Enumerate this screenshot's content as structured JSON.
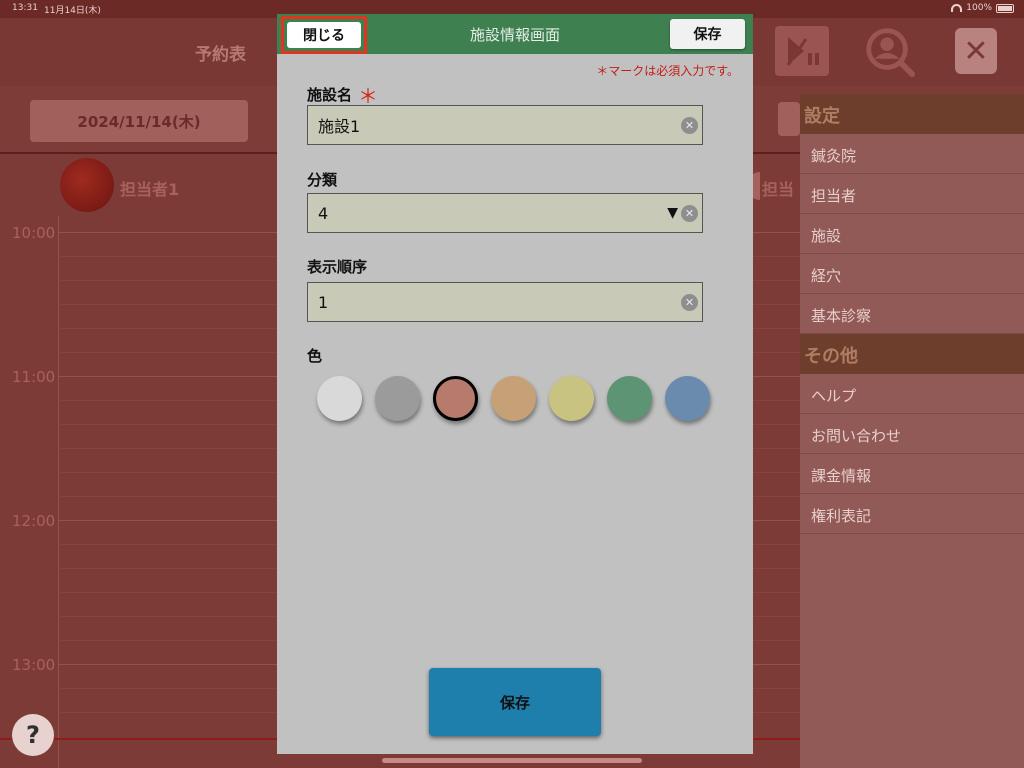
{
  "status_bar": {
    "time": "13:31",
    "date": "11月14日(木)",
    "battery": "100%"
  },
  "app": {
    "title": "予約表",
    "date": "2024/11/14(木)",
    "staff": [
      "担当者1",
      "担当"
    ],
    "times": [
      "10:00",
      "11:00",
      "12:00",
      "13:00"
    ],
    "help_label": "?",
    "close_label": "✕"
  },
  "side_menu": {
    "settings_header": "設定",
    "settings_items": [
      "鍼灸院",
      "担当者",
      "施設",
      "経穴",
      "基本診察"
    ],
    "other_header": "その他",
    "other_items": [
      "ヘルプ",
      "お問い合わせ",
      "課金情報",
      "権利表記"
    ]
  },
  "modal": {
    "title": "施設情報画面",
    "close_label": "閉じる",
    "save_label": "保存",
    "required_note": "＊マークは必須入力です。",
    "fields": {
      "name_label": "施設名",
      "required_mark": "＊",
      "name_value": "施設1",
      "category_label": "分類",
      "category_value": "4",
      "order_label": "表示順序",
      "order_value": "1",
      "color_label": "色"
    },
    "colors": [
      {
        "hex": "#d9d9d9",
        "selected": false
      },
      {
        "hex": "#9b9b9b",
        "selected": false
      },
      {
        "hex": "#b67b6d",
        "selected": true
      },
      {
        "hex": "#c6a076",
        "selected": false
      },
      {
        "hex": "#c8c381",
        "selected": false
      },
      {
        "hex": "#5d9474",
        "selected": false
      },
      {
        "hex": "#6a8bad",
        "selected": false
      }
    ],
    "bottom_save_label": "保存"
  }
}
